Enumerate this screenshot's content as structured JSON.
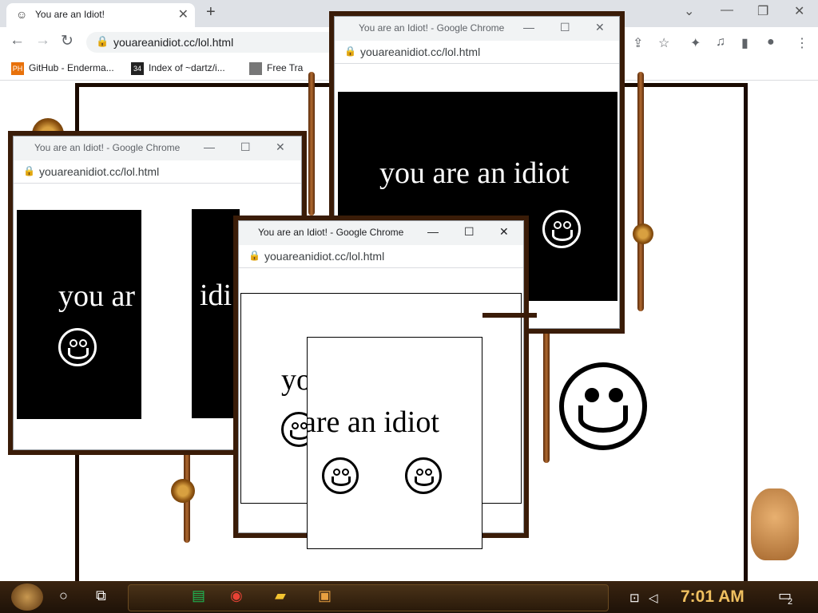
{
  "browser": {
    "tab_title": "You are an Idiot!",
    "tab_close": "✕",
    "new_tab": "+",
    "url": "youareanidiot.cc/lol.html",
    "bookmarks": [
      {
        "icon_text": "PH",
        "label": "GitHub - Enderma..."
      },
      {
        "icon_text": "34",
        "label": "Index of ~dartz/i..."
      },
      {
        "icon_text": "",
        "label": "Free Tra"
      }
    ]
  },
  "popups": [
    {
      "title": "You are an Idiot! - Google Chrome",
      "url": "youareanidiot.cc/lol.html",
      "message": "you are an idiot"
    },
    {
      "title": "You are an Idiot! - Google Chrome",
      "url": "youareanidiot.cc/lol.html",
      "message": "you ar"
    },
    {
      "title": "You are an Idiot! - Google Chrome",
      "url": "youareanidiot.cc/lol.html",
      "message": "yo"
    }
  ],
  "fragments": {
    "idi": "idi",
    "are_an_idiot": "are an idiot"
  },
  "taskbar": {
    "clock": "7:01 AM",
    "notification_count": "2"
  },
  "icons": {
    "lock": "lock-icon",
    "smiley": "smiley-icon",
    "back": "back-arrow-icon",
    "forward": "forward-arrow-icon",
    "reload": "reload-icon"
  },
  "colors": {
    "accent_gold": "#f0c060",
    "frame_brown": "#3a1c08"
  }
}
